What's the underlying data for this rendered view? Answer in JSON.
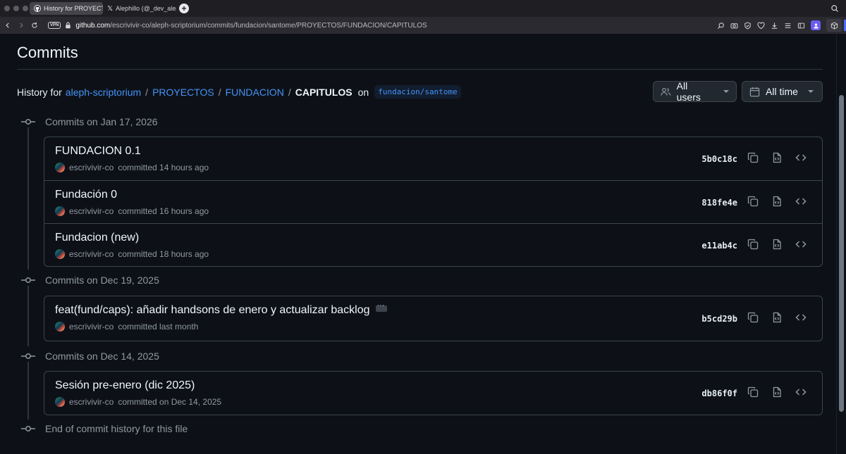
{
  "browser": {
    "tabs": [
      {
        "label": "History for PROYECTOS",
        "active": true
      },
      {
        "label": "Alephillo (@_dev_aleph_",
        "active": false
      }
    ],
    "new_tab": "+",
    "vpn": "VPN",
    "url_host": "github.com",
    "url_path": "/escrivivir-co/aleph-scriptorium/commits/fundacion/santome/PROYECTOS/FUNDACION/CAPITULOS"
  },
  "page": {
    "title": "Commits",
    "history_prefix": "History for",
    "breadcrumb": [
      "aleph-scriptorium",
      "PROYECTOS",
      "FUNDACION"
    ],
    "separator": "/",
    "current": "CAPITULOS",
    "on": "on",
    "branch": "fundacion/santome",
    "filters": {
      "users": "All users",
      "time": "All time"
    }
  },
  "groups": [
    {
      "heading": "Commits on Jan 17, 2026",
      "commits": [
        {
          "title": "FUNDACION 0.1",
          "author": "escrivivir-co",
          "when": "committed 14 hours ago",
          "sha": "5b0c18c",
          "ellipsis": false
        },
        {
          "title": "Fundación 0",
          "author": "escrivivir-co",
          "when": "committed 16 hours ago",
          "sha": "818fe4e",
          "ellipsis": false
        },
        {
          "title": "Fundacion (new)",
          "author": "escrivivir-co",
          "when": "committed 18 hours ago",
          "sha": "e11ab4c",
          "ellipsis": false
        }
      ]
    },
    {
      "heading": "Commits on Dec 19, 2025",
      "commits": [
        {
          "title": "feat(fund/caps): añadir handsons de enero y actualizar backlog",
          "author": "escrivivir-co",
          "when": "committed last month",
          "sha": "b5cd29b",
          "ellipsis": true
        }
      ]
    },
    {
      "heading": "Commits on Dec 14, 2025",
      "commits": [
        {
          "title": "Sesión pre-enero (dic 2025)",
          "author": "escrivivir-co",
          "when": "committed on Dec 14, 2025",
          "sha": "db86f0f",
          "ellipsis": false
        }
      ]
    }
  ],
  "end_text": "End of commit history for this file",
  "colors": {
    "background": "#0d1117",
    "link": "#4493f8",
    "border": "#3d444d",
    "muted": "#9198a1"
  }
}
